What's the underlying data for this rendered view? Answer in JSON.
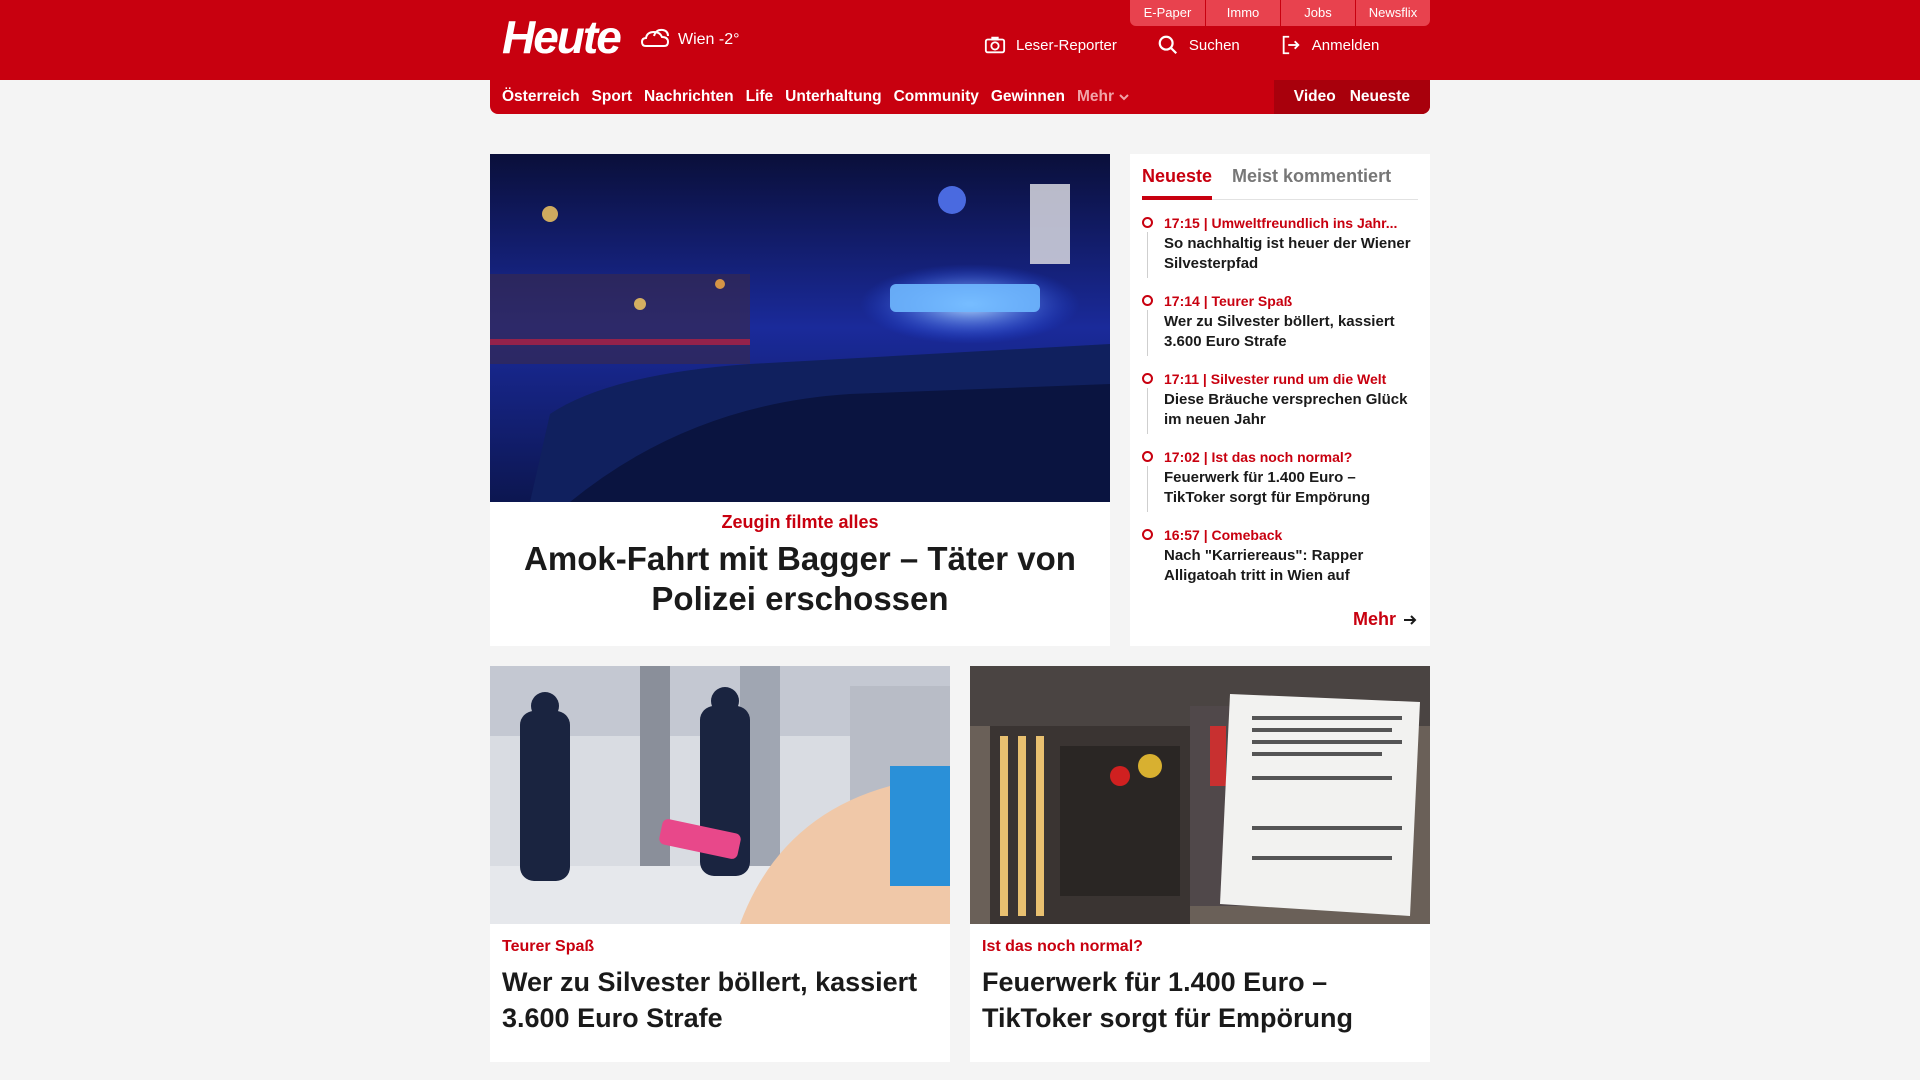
{
  "header": {
    "logo": "Heute",
    "weather": "Wien -2°",
    "service_tabs": [
      "E-Paper",
      "Immo",
      "Jobs",
      "Newsflix"
    ],
    "actions": {
      "reporter": "Leser-Reporter",
      "search": "Suchen",
      "login": "Anmelden"
    }
  },
  "nav": {
    "items": [
      "Österreich",
      "Sport",
      "Nachrichten",
      "Life",
      "Unterhaltung",
      "Community",
      "Gewinnen"
    ],
    "more": "Mehr",
    "right": [
      "Video",
      "Neueste"
    ]
  },
  "hero": {
    "kicker": "Zeugin filmte alles",
    "title": "Amok-Fahrt mit Bagger – Täter von Polizei erschossen"
  },
  "sidebar": {
    "tabs": [
      "Neueste",
      "Meist kommentiert"
    ],
    "items": [
      {
        "kicker": "17:15 | Umweltfreundlich ins Jahr...",
        "title": "So nachhaltig ist heuer der Wiener Silvesterpfad"
      },
      {
        "kicker": "17:14 | Teurer Spaß",
        "title": "Wer zu Silvester böllert, kassiert 3.600 Euro Strafe"
      },
      {
        "kicker": "17:11 | Silvester rund um die Welt",
        "title": "Diese Bräuche versprechen Glück im neuen Jahr"
      },
      {
        "kicker": "17:02 | Ist das noch normal?",
        "title": "Feuerwerk für 1.400 Euro – TikToker sorgt für Empörung"
      },
      {
        "kicker": "16:57 | Comeback",
        "title": "Nach \"Karriereaus\": Rapper Alligatoah tritt in Wien auf"
      }
    ],
    "more": "Mehr"
  },
  "cards": [
    {
      "kicker": "Teurer Spaß",
      "title": "Wer zu Silvester böllert, kassiert 3.600 Euro Strafe"
    },
    {
      "kicker": "Ist das noch normal?",
      "title": "Feuerwerk für 1.400 Euro – TikToker sorgt für Empörung"
    }
  ],
  "colors": {
    "brand": "#c8000f",
    "background": "#f4f4f4"
  }
}
